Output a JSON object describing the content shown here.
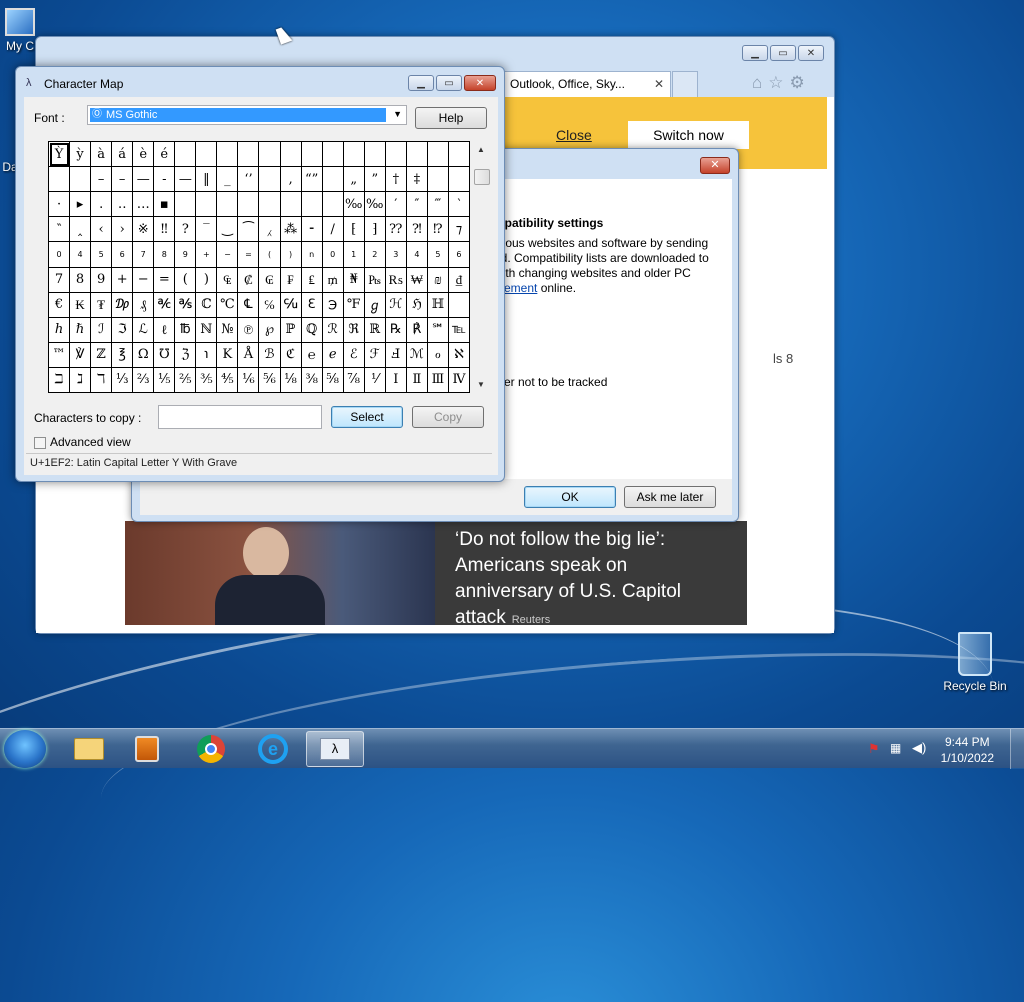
{
  "desktop": {
    "icons": [
      {
        "name": "My Computer",
        "label": "My C"
      },
      {
        "name": "Da",
        "label": "Da"
      },
      {
        "name": "Recycle Bin",
        "label": "Recycle Bin"
      }
    ]
  },
  "ie": {
    "tab_title": "Outlook, Office, Sky...",
    "tab_close": "✕",
    "banner_close": "Close",
    "banner_switch": "Switch now",
    "side_text": "ls 8",
    "news_headline": "‘Do not follow the big lie’: Americans speak on anniversary of U.S. Capitol attack",
    "news_source": "Reuters"
  },
  "dialog": {
    "heading": "mpatibility settings",
    "para_1": "icious websites and software by sending",
    "para_2": "ed. Compatibility lists are downloaded to",
    "para_3": "with changing websites and older PC",
    "para_link": "atement",
    "para_4": " online.",
    "tracking": "efer not to be tracked",
    "ok": "OK",
    "ask_later": "Ask me later"
  },
  "charmap": {
    "title": "Character Map",
    "font_label": "Font :",
    "font_value": "MS Gothic",
    "help": "Help",
    "copy_label": "Characters to copy :",
    "copy_value": "",
    "select": "Select",
    "copy": "Copy",
    "advanced": "Advanced view",
    "status": "U+1EF2: Latin Capital Letter Y With Grave",
    "grid": [
      "Ỳ",
      "ỳ",
      "à",
      "á",
      "è",
      "é",
      "",
      "",
      "",
      "",
      "",
      "",
      "",
      "",
      "",
      "",
      "",
      "",
      "",
      "",
      "",
      "",
      "–",
      "–",
      "—",
      "-",
      "—",
      "‖",
      "_",
      "‘’",
      "",
      "‚",
      "“”",
      "",
      "„",
      "”",
      "†",
      "‡",
      "",
      "",
      "·",
      "▸",
      "․",
      "‥",
      "…",
      "▪",
      "",
      "",
      "",
      "",
      "",
      "",
      "",
      "",
      "‰",
      "‰",
      "′",
      "″",
      "‴",
      "‵",
      "‶",
      "‸",
      "‹",
      "›",
      "※",
      "‼",
      "?",
      "‾",
      "‿",
      "⁀",
      "⁁",
      "⁂",
      "⁃",
      "/",
      "⁅",
      "⁆",
      "⁇",
      "⁈",
      "⁉",
      "⁊",
      "0",
      "4",
      "5",
      "6",
      "7",
      "8",
      "9",
      "+",
      "−",
      "=",
      "(",
      ")",
      "n",
      "0",
      "1",
      "2",
      "3",
      "4",
      "5",
      "6",
      "7",
      "8",
      "9",
      "+",
      "−",
      "=",
      "(",
      ")",
      "₠",
      "₡",
      "₢",
      "₣",
      "₤",
      "₥",
      "₦",
      "₧",
      "₨",
      "₩",
      "₪",
      "₫",
      "€",
      "₭",
      "₮",
      "₯",
      "₰",
      "℀",
      "℁",
      "ℂ",
      "℃",
      "℄",
      "℅",
      "℆",
      "ℇ",
      "℈",
      "℉",
      "ℊ",
      "ℋ",
      "ℌ",
      "ℍ",
      "",
      "ℎ",
      "ℏ",
      "ℐ",
      "ℑ",
      "ℒ",
      "ℓ",
      "℔",
      "ℕ",
      "№",
      "℗",
      "℘",
      "ℙ",
      "ℚ",
      "ℛ",
      "ℜ",
      "ℝ",
      "℞",
      "℟",
      "℠",
      "℡",
      "™",
      "℣",
      "ℤ",
      "℥",
      "Ω",
      "℧",
      "ℨ",
      "℩",
      "K",
      "Å",
      "ℬ",
      "ℭ",
      "℮",
      "ℯ",
      "ℰ",
      "ℱ",
      "Ⅎ",
      "ℳ",
      "ℴ",
      "ℵ",
      "ℶ",
      "ℷ",
      "ℸ",
      "⅓",
      "⅔",
      "⅕",
      "⅖",
      "⅗",
      "⅘",
      "⅙",
      "⅚",
      "⅛",
      "⅜",
      "⅝",
      "⅞",
      "⅟",
      "Ⅰ",
      "Ⅱ",
      "Ⅲ",
      "Ⅳ"
    ]
  },
  "taskbar": {
    "time": "9:44 PM",
    "date": "1/10/2022"
  }
}
